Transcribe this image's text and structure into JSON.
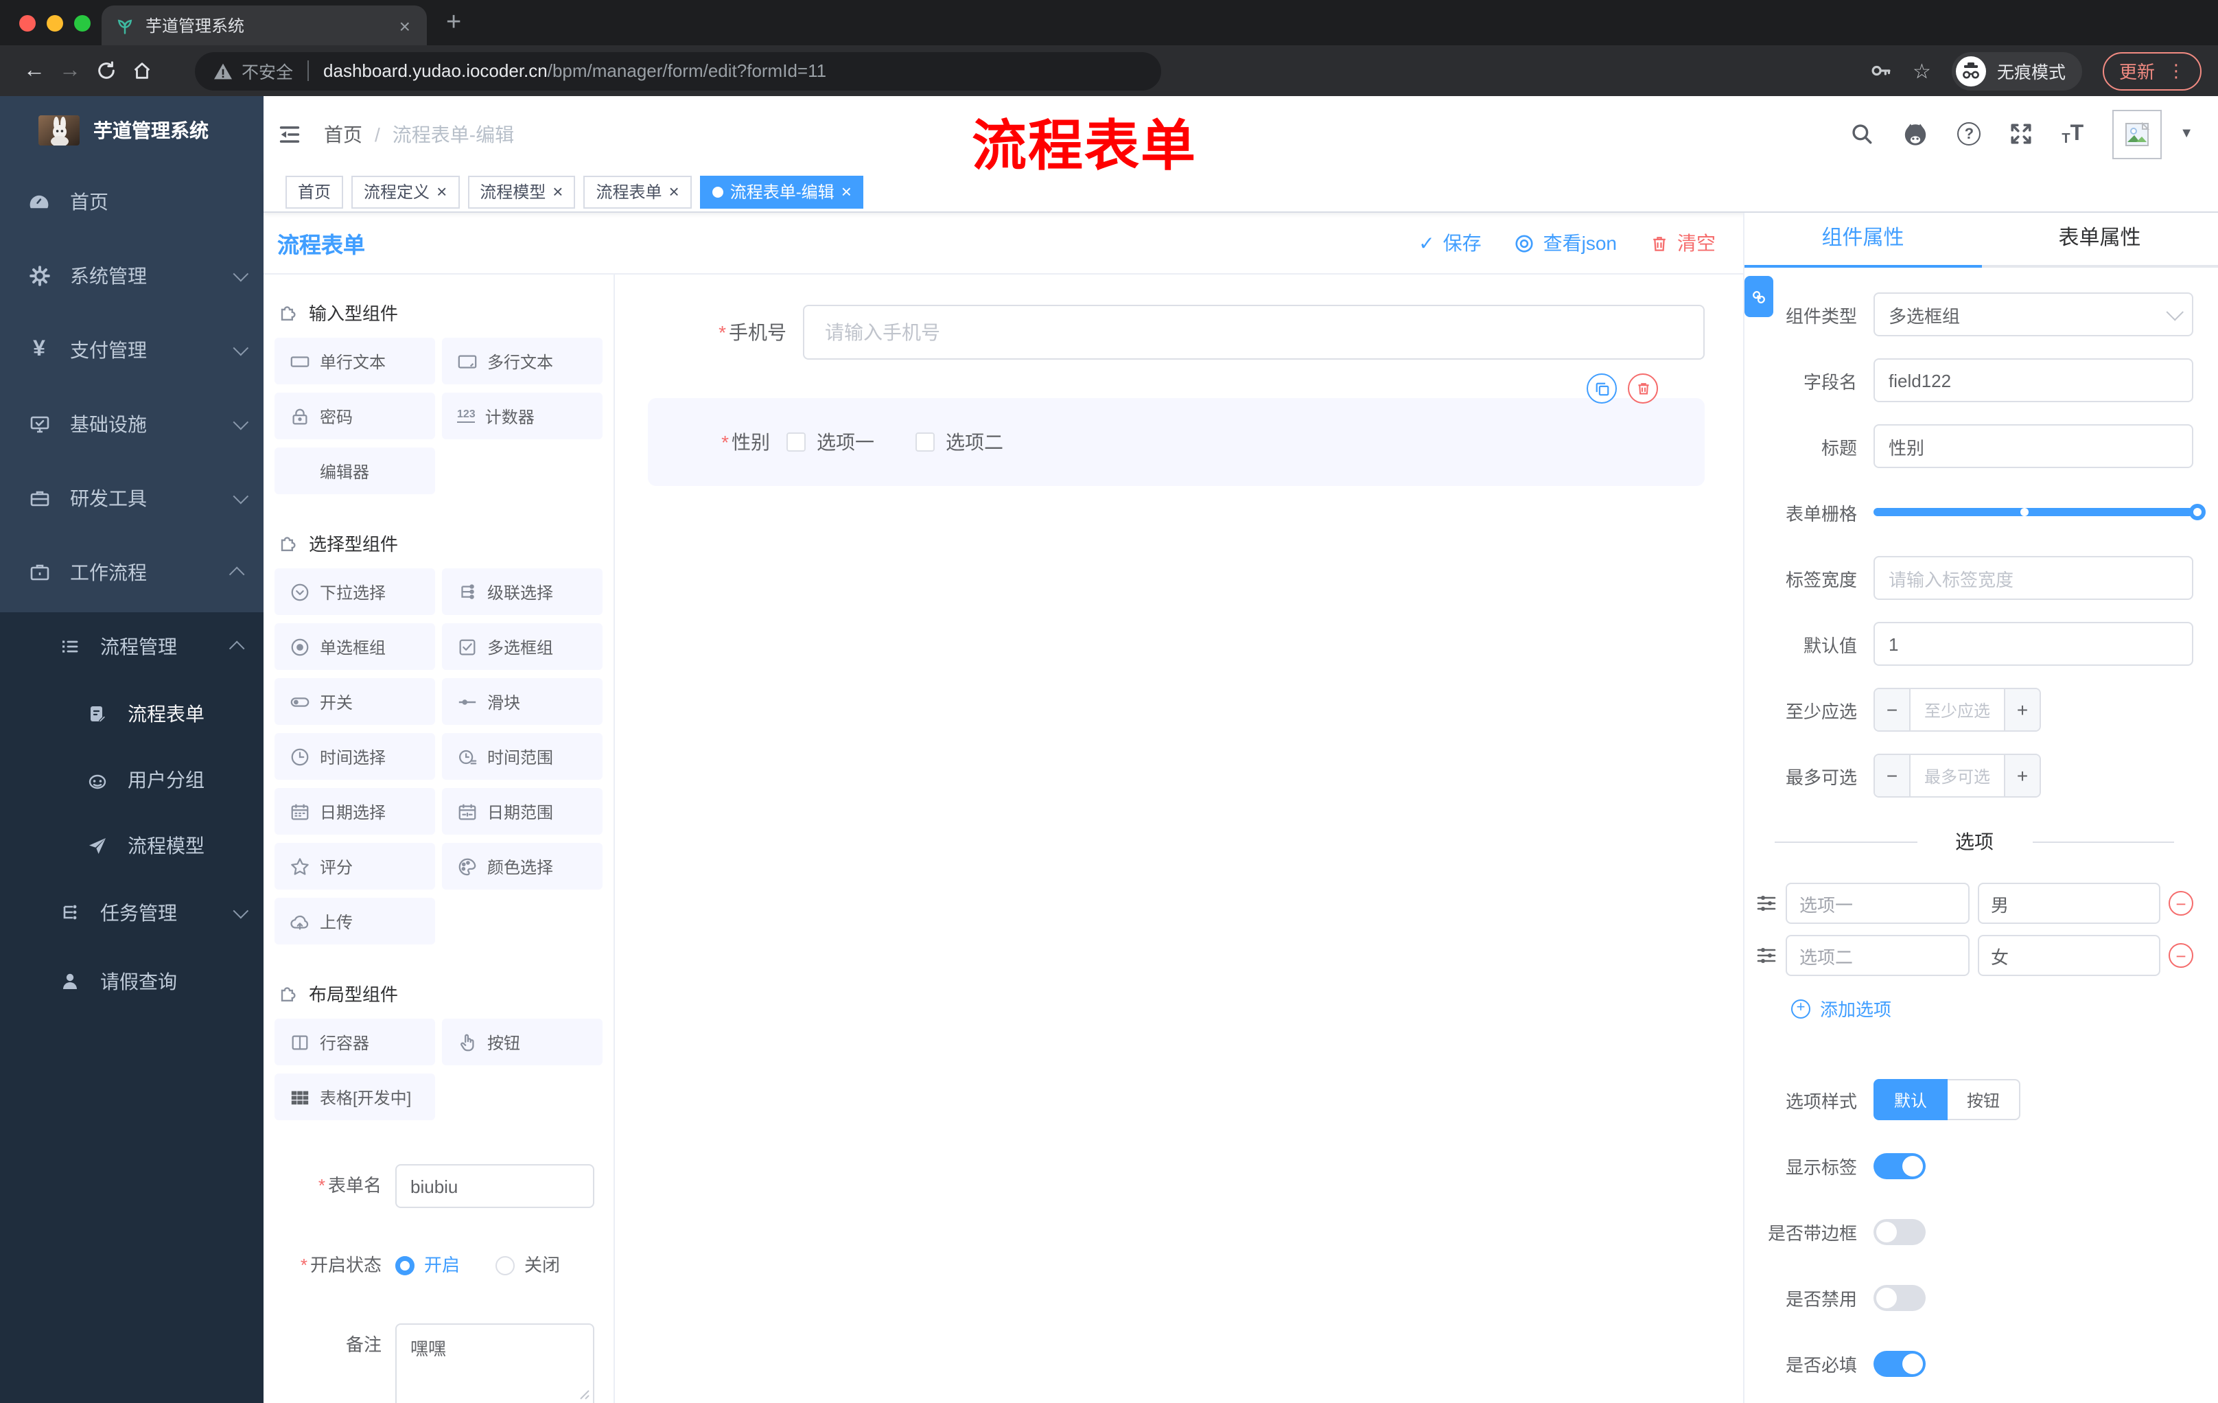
{
  "glyphs": {
    "close": "×",
    "plus": "+",
    "check": "✓",
    "dots_vertical": "⋮",
    "arrow_back": "←",
    "arrow_forward": "→",
    "star": "☆",
    "caret_down": "▼",
    "slash": "/",
    "required": "*",
    "minus": "−",
    "question": "?",
    "text_small": "T",
    "text_large": "T",
    "counter": "123"
  },
  "colors": {
    "accent": "#409eff",
    "danger": "#f56c6c",
    "annotation": "#ff0000"
  },
  "browser": {
    "tab_title": "芋道管理系统",
    "security_label": "不安全",
    "url_host": "dashboard.yudao.iocoder.cn",
    "url_path": "/bpm/manager/form/edit?formId=11",
    "incognito_label": "无痕模式",
    "update_label": "更新"
  },
  "sidebar": {
    "app_title": "芋道管理系统",
    "items": [
      {
        "label": "首页"
      },
      {
        "label": "系统管理"
      },
      {
        "label": "支付管理"
      },
      {
        "label": "基础设施"
      },
      {
        "label": "研发工具"
      },
      {
        "label": "工作流程"
      }
    ],
    "submenu": {
      "label": "流程管理",
      "children": [
        "流程表单",
        "用户分组",
        "流程模型"
      ]
    },
    "tasks_label": "任务管理",
    "leave_label": "请假查询"
  },
  "navbar": {
    "breadcrumb_home": "首页",
    "breadcrumb_current": "流程表单-编辑",
    "annotation": "流程表单"
  },
  "tags": [
    "首页",
    "流程定义",
    "流程模型",
    "流程表单",
    "流程表单-编辑"
  ],
  "designer": {
    "title": "流程表单",
    "actions": {
      "save": "保存",
      "view_json": "查看json",
      "clear": "清空"
    },
    "palette": {
      "sections": [
        {
          "title": "输入型组件",
          "items": [
            "单行文本",
            "多行文本",
            "密码",
            "计数器",
            "编辑器"
          ]
        },
        {
          "title": "选择型组件",
          "items": [
            "下拉选择",
            "级联选择",
            "单选框组",
            "多选框组",
            "开关",
            "滑块",
            "时间选择",
            "时间范围",
            "日期选择",
            "日期范围",
            "评分",
            "颜色选择",
            "上传"
          ]
        },
        {
          "title": "布局型组件",
          "items": [
            "行容器",
            "按钮",
            "表格[开发中]"
          ]
        }
      ]
    },
    "meta": {
      "name_label": "表单名",
      "name_value": "biubiu",
      "status_label": "开启状态",
      "status_on": "开启",
      "status_off": "关闭",
      "remark_label": "备注",
      "remark_value": "嘿嘿"
    },
    "canvas": {
      "phone_label": "手机号",
      "phone_placeholder": "请输入手机号",
      "gender_label": "性别",
      "gender_opt1": "选项一",
      "gender_opt2": "选项二"
    },
    "props": {
      "tab_component": "组件属性",
      "tab_form": "表单属性",
      "comp_type_label": "组件类型",
      "comp_type_value": "多选框组",
      "field_label": "字段名",
      "field_value": "field122",
      "title_label": "标题",
      "title_value": "性别",
      "grid_label": "表单栅格",
      "label_width_label": "标签宽度",
      "label_width_placeholder": "请输入标签宽度",
      "default_label": "默认值",
      "default_value": "1",
      "min_label": "至少应选",
      "min_placeholder": "至少应选",
      "max_label": "最多可选",
      "max_placeholder": "最多可选",
      "options_divider": "选项",
      "opt1_label": "选项一",
      "opt1_value": "男",
      "opt2_label": "选项二",
      "opt2_value": "女",
      "add_option": "添加选项",
      "style_label": "选项样式",
      "style_default": "默认",
      "style_button": "按钮",
      "switch_show_label": "显示标签",
      "switch_border": "是否带边框",
      "switch_disabled": "是否禁用",
      "switch_required": "是否必填"
    }
  }
}
